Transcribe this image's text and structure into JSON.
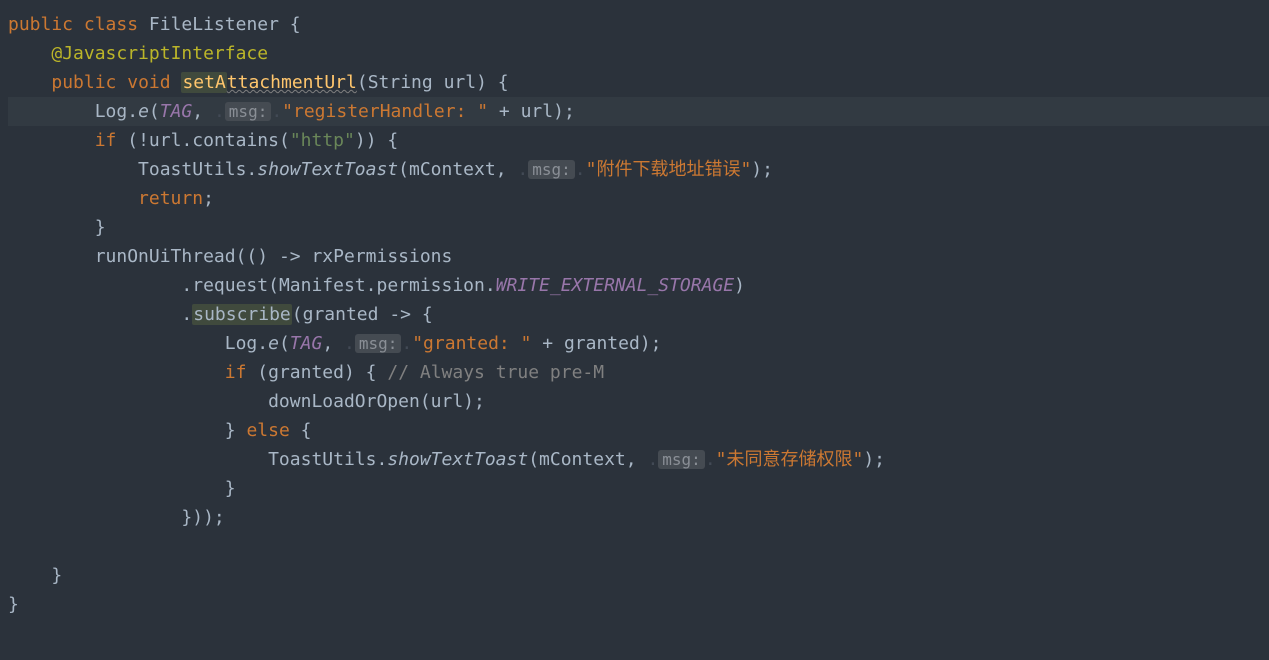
{
  "code": {
    "kw_public": "public",
    "kw_class": "class",
    "class_name": "FileListener",
    "annotation": "@JavascriptInterface",
    "kw_void": "void",
    "method_setAttachmentUrl_a": "setA",
    "method_setAttachmentUrl_b": "ttachmentUrl",
    "type_String": "String",
    "param_url": "url",
    "ident_Log": "Log",
    "method_e": "e",
    "ident_TAG": "TAG",
    "hint_msg": "msg:",
    "str_registerHandler": "\"registerHandler: \"",
    "op_plus": " + ",
    "kw_if": "if",
    "op_not": "!",
    "method_contains": "contains",
    "str_http": "\"http\"",
    "ident_ToastUtils": "ToastUtils",
    "method_showTextToast": "showTextToast",
    "ident_mContext": "mContext",
    "str_addr_error": "\"附件下载地址错误\"",
    "kw_return": "return",
    "method_runOnUiThread": "runOnUiThread",
    "lambda_arrow": " -> ",
    "ident_rxPermissions": "rxPermissions",
    "method_request": "request",
    "ident_Manifest": "Manifest",
    "ident_permission": "permission",
    "const_WRITE_EXTERNAL_STORAGE": "WRITE_EXTERNAL_STORAGE",
    "method_subscribe": "subscribe",
    "param_granted": "granted",
    "str_granted": "\"granted: \"",
    "comment_preM": "// Always true pre-M",
    "method_downLoadOrOpen": "downLoadOrOpen",
    "kw_else": "else",
    "str_no_permission": "\"未同意存储权限\""
  }
}
